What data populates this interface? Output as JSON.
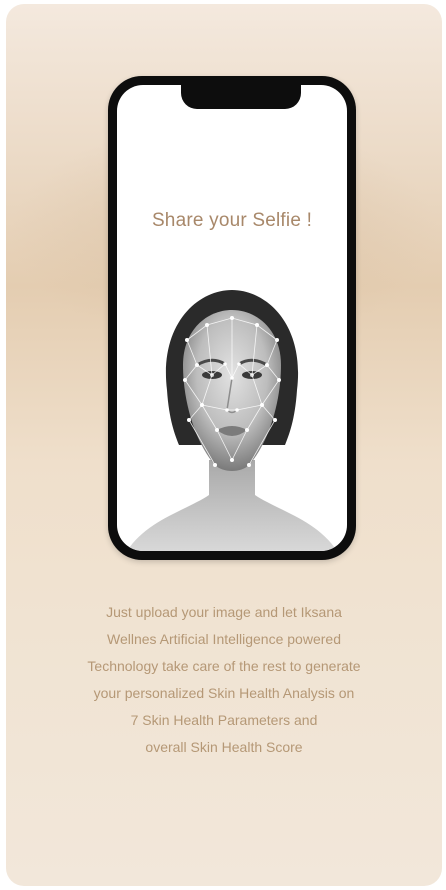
{
  "screen": {
    "title": "Share your Selfie !"
  },
  "description": {
    "lines": [
      "Just upload your image and let Iksana",
      "Wellnes Artificial Intelligence powered",
      "Technology take care of the rest to generate",
      "your personalized Skin Health Analysis on",
      "7 Skin Health Parameters and",
      "overall Skin Health Score"
    ]
  },
  "colors": {
    "accent_text": "#b59876",
    "phone_frame": "#0d0d0d",
    "background": "#ecdcc8"
  },
  "icons": {
    "face_image": "face-mesh-image"
  }
}
